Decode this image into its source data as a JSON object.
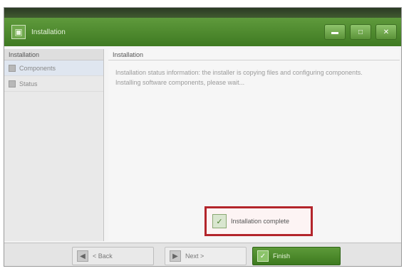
{
  "window": {
    "title": "Installation",
    "app_icon": "installer-icon"
  },
  "window_buttons": [
    {
      "name": "minimize-icon",
      "glyph": "▬"
    },
    {
      "name": "maximize-icon",
      "glyph": "□"
    },
    {
      "name": "close-icon",
      "glyph": "✕"
    }
  ],
  "sidebar": {
    "header": "Installation",
    "items": [
      {
        "label": "Components",
        "icon": "component-icon"
      },
      {
        "label": "Status",
        "icon": "status-icon"
      }
    ]
  },
  "content": {
    "header": "Installation",
    "lines": [
      "Installation status information: the installer is copying files and configuring components.",
      "Installing software components, please wait..."
    ]
  },
  "notification": {
    "icon": "checkmark-icon",
    "text": "Installation complete"
  },
  "footer": {
    "back_label": "< Back",
    "next_label": "Next >",
    "primary_label": "Finish"
  },
  "colors": {
    "accent": "#4d8a2c",
    "highlight_border": "#b3252b"
  }
}
